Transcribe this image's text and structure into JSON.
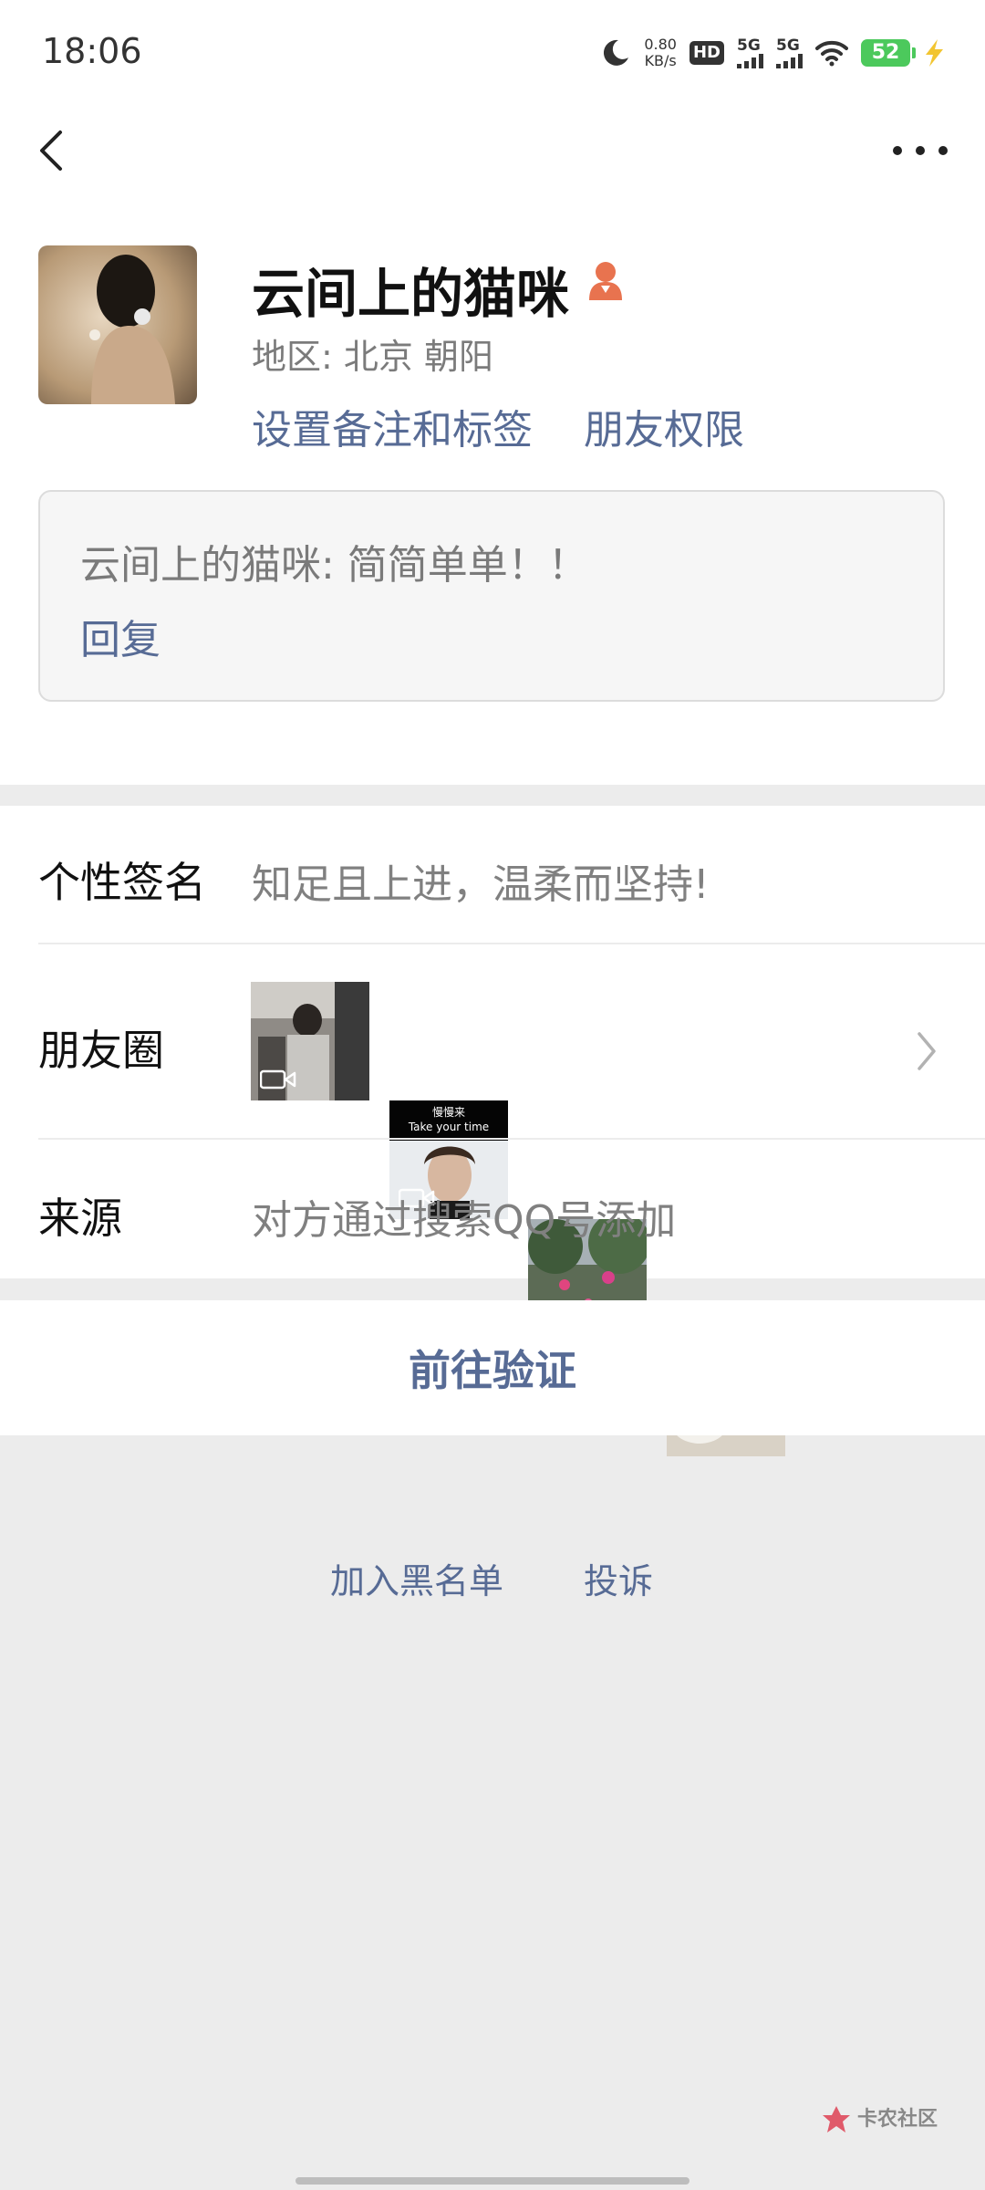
{
  "status_bar": {
    "time": "18:06",
    "net_speed_value": "0.80",
    "net_speed_unit": "KB/s",
    "hd_label": "HD",
    "sim1_label": "5G",
    "sim2_label": "5G",
    "battery_level": "52"
  },
  "profile": {
    "display_name": "云间上的猫咪",
    "region": "地区:  北京  朝阳",
    "set_remark_label": "设置备注和标签",
    "friend_permissions_label": "朋友权限"
  },
  "message": {
    "text": "云间上的猫咪: 简简单单！！",
    "reply_label": "回复"
  },
  "info": {
    "signature_label": "个性签名",
    "signature_value": "知足且上进，温柔而坚持!",
    "moments_label": "朋友圈",
    "moments_thumb2_line1": "慢慢来",
    "moments_thumb2_line2": "Take your time",
    "source_label": "来源",
    "source_value": "对方通过搜索QQ号添加"
  },
  "actions": {
    "verify_label": "前往验证",
    "blacklist_label": "加入黑名单",
    "report_label": "投诉"
  },
  "watermark": {
    "text": "卡农社区"
  },
  "colors": {
    "link": "#576b95",
    "background": "#ececec",
    "battery": "#4cc95c",
    "gender_icon": "#e8734f"
  }
}
